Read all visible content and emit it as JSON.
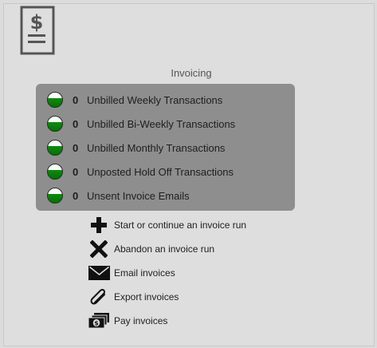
{
  "header": {
    "title": "Invoicing",
    "icon": "invoice-document-icon"
  },
  "status_items": [
    {
      "count": "0",
      "label": "Unbilled Weekly Transactions",
      "status_color": "#0f8a0f"
    },
    {
      "count": "0",
      "label": "Unbilled Bi-Weekly Transactions",
      "status_color": "#0f8a0f"
    },
    {
      "count": "0",
      "label": "Unbilled Monthly Transactions",
      "status_color": "#0f8a0f"
    },
    {
      "count": "0",
      "label": "Unposted Hold Off Transactions",
      "status_color": "#0f8a0f"
    },
    {
      "count": "0",
      "label": "Unsent Invoice Emails",
      "status_color": "#0f8a0f"
    }
  ],
  "actions": [
    {
      "label": "Start or continue an invoice run",
      "icon": "plus-icon"
    },
    {
      "label": "Abandon an invoice run",
      "icon": "x-icon"
    },
    {
      "label": "Email invoices",
      "icon": "envelope-icon"
    },
    {
      "label": "Export invoices",
      "icon": "paperclip-icon"
    },
    {
      "label": "Pay invoices",
      "icon": "cash-icon"
    }
  ]
}
